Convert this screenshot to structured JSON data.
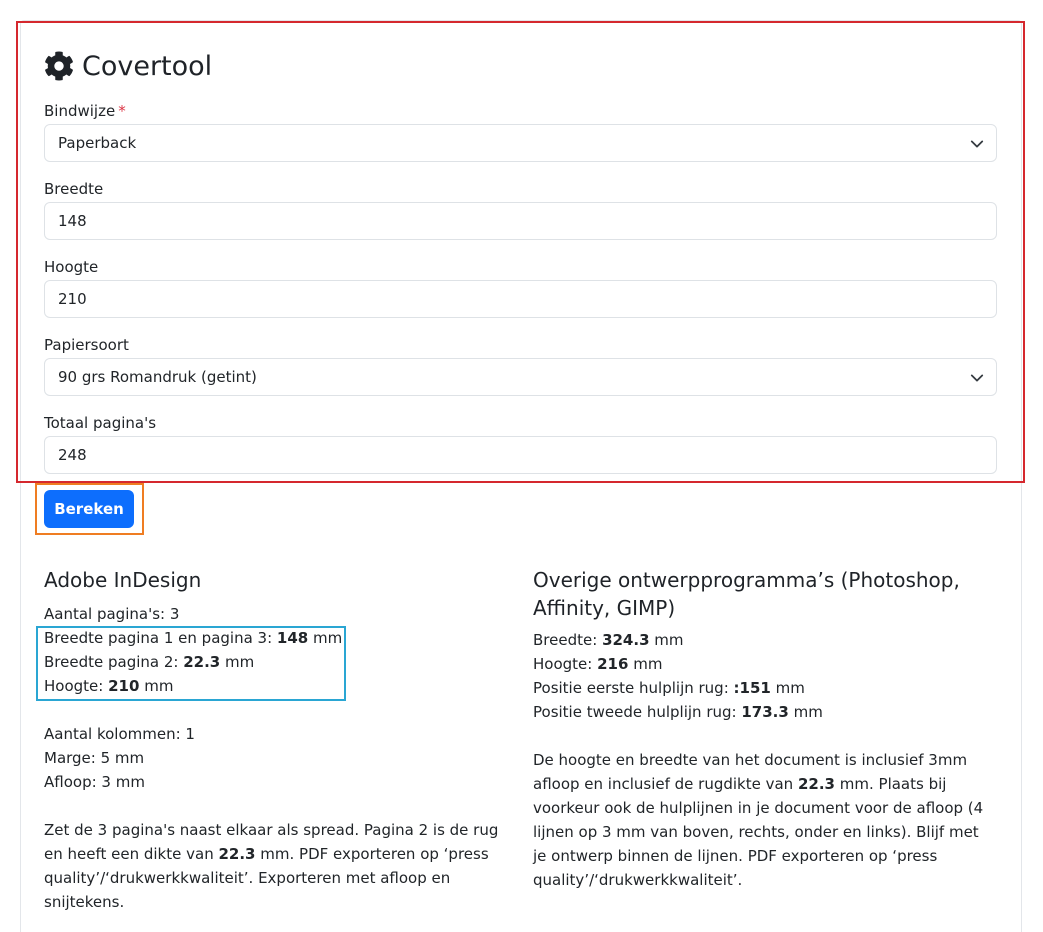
{
  "title": "Covertool",
  "form": {
    "binding_label": "Bindwijze",
    "binding_required": "*",
    "binding_value": "Paperback",
    "width_label": "Breedte",
    "width_value": "148",
    "height_label": "Hoogte",
    "height_value": "210",
    "paper_label": "Papiersoort",
    "paper_value": "90 grs Romandruk (getint)",
    "pages_label": "Totaal pagina's",
    "pages_value": "248"
  },
  "button": {
    "label": "Bereken"
  },
  "indesign": {
    "heading": "Adobe InDesign",
    "pages": "Aantal pagina's: 3",
    "w13_label": "Breedte pagina 1 en pagina 3:",
    "w13_value": "148",
    "w2_label": "Breedte pagina 2:",
    "w2_value": "22.3",
    "h_label": "Hoogte:",
    "h_value": "210",
    "unit": "mm",
    "columns": "Aantal kolommen: 1",
    "margin": "Marge: 5 mm",
    "bleed": "Afloop: 3 mm",
    "note_1": "Zet de 3 pagina's naast elkaar als spread. Pagina 2 is de rug en heeft een dikte van",
    "note_value": "22.3",
    "note_2": "mm. PDF exporteren op ‘press quality’/‘drukwerkkwaliteit’. Exporteren met afloop en snijtekens."
  },
  "other": {
    "heading": "Overige ontwerpprogramma’s (Photoshop, Affinity, GIMP)",
    "w_label": "Breedte:",
    "w_value": "324.3",
    "h_label": "Hoogte:",
    "h_value": "216",
    "g1_label": "Positie eerste hulplijn rug:",
    "g1_value": ":151",
    "g2_label": "Positie tweede hulplijn rug:",
    "g2_value": "173.3",
    "unit": "mm",
    "note_1": "De hoogte en breedte van het document is inclusief 3mm afloop en inclusief de rugdikte van",
    "note_value": "22.3",
    "note_2": "mm. Plaats bij voorkeur ook de hulplijnen in je document voor de afloop (4 lijnen op 3 mm van boven, rechts, onder en links). Blijf met je ontwerp binnen de lijnen. PDF exporteren op ‘press quality’/‘drukwerkkwaliteit’."
  },
  "colors": {
    "primary": "#0d6efd",
    "highlight_red": "#d5282e",
    "highlight_orange": "#ef7d22",
    "highlight_blue": "#2aa6d3",
    "required": "#dc3545"
  },
  "icons": {
    "title_icon": "gear-icon",
    "select_icon": "chevron-down-icon"
  }
}
